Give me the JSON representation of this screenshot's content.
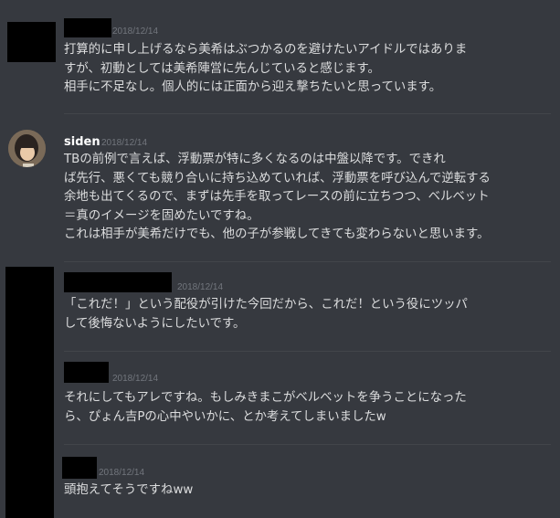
{
  "messages": [
    {
      "timestamp": "2018/12/14",
      "lines": [
        "打算的に申し上げるなら美希はぶつかるのを避けたいアイドルではありま",
        "すが、初動としては美希陣営に先んじていると感じます。",
        "相手に不足なし。個人的には正面から迎え撃ちたいと思っています。"
      ]
    },
    {
      "username": "siden",
      "timestamp": "2018/12/14",
      "lines": [
        "TBの前例で言えば、浮動票が特に多くなるのは中盤以降です。できれ",
        "ば先行、悪くても競り合いに持ち込めていれば、浮動票を呼び込んで逆転する",
        "余地も出てくるので、まずは先手を取ってレースの前に立ちつつ、ベルベット",
        "＝真のイメージを固めたいですね。",
        "これは相手が美希だけでも、他の子が参戦してきても変わらないと思います。"
      ]
    },
    {
      "timestamp": "2018/12/14",
      "lines": [
        "「これだ！」という配役が引けた今回だから、これだ！という役にツッパ",
        "して後悔ないようにしたいです。"
      ]
    },
    {
      "timestamp": "2018/12/14",
      "lines": [
        "それにしてもアレですね。もしみきまこがベルベットを争うことになった",
        "ら、ぴょん吉Pの心中やいかに、とか考えてしまいましたw"
      ]
    },
    {
      "timestamp": "2018/12/14",
      "lines": [
        "頭抱えてそうですねww"
      ]
    }
  ]
}
